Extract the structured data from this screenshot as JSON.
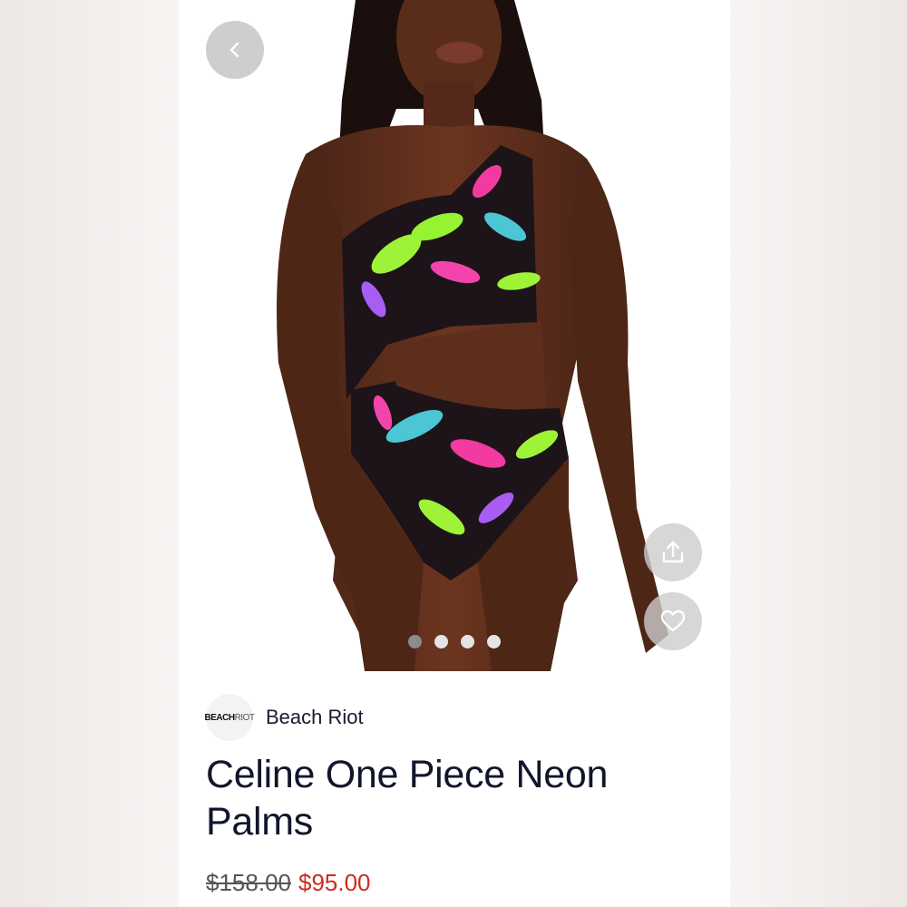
{
  "product": {
    "brand_logo_text_bold": "BEACH",
    "brand_logo_text_thin": "RIOT",
    "brand_name": "Beach Riot",
    "title": "Celine One Piece Neon Palms",
    "original_price": "$158.00",
    "sale_price": "$95.00"
  },
  "carousel": {
    "count": 4,
    "active_index": 0
  },
  "icons": {
    "back": "chevron-left-icon",
    "share": "share-icon",
    "favorite": "heart-icon"
  },
  "colors": {
    "sale_price": "#d02b1e",
    "title": "#12162b"
  }
}
